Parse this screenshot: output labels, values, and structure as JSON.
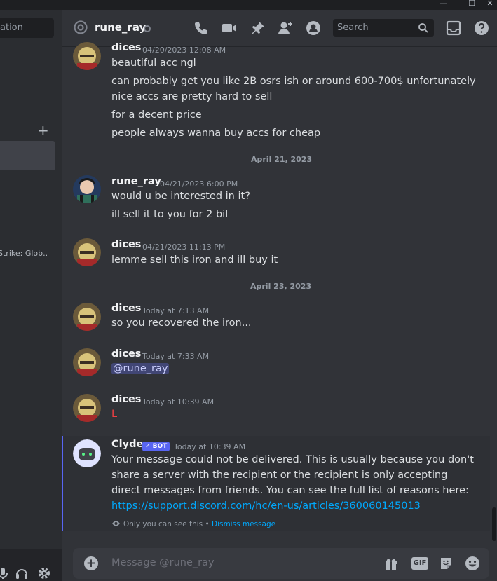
{
  "window": {
    "minimize": "—",
    "maximize": "☐",
    "close": "✕"
  },
  "sidebar": {
    "find_text": "ation",
    "dm_add": "+",
    "activity_status": "Strike: Glob..."
  },
  "header": {
    "username": "rune_ray",
    "search_placeholder": "Search"
  },
  "messages": [
    {
      "author": "dices",
      "timestamp": "04/20/2023 12:08 AM",
      "lines": [
        "beautiful acc ngl",
        "can probably get you like 2B osrs ish or around 600-700$ unfortunately",
        "nice accs are pretty hard to sell",
        "for a decent price",
        "people always wanna buy accs for cheap"
      ]
    },
    {
      "divider": "April 21, 2023"
    },
    {
      "author": "rune_ray",
      "timestamp": "04/21/2023 6:00 PM",
      "lines": [
        "would u be interested in it?",
        "ill sell it to you for 2 bil"
      ]
    },
    {
      "author": "dices",
      "timestamp": "04/21/2023 11:13 PM",
      "lines": [
        "lemme sell this iron and ill buy it"
      ]
    },
    {
      "divider": "April 23, 2023"
    },
    {
      "author": "dices",
      "timestamp": "Today at 7:13 AM",
      "lines": [
        "so you recovered the iron..."
      ]
    },
    {
      "author": "dices",
      "timestamp": "Today at 7:33 AM",
      "mention": "@rune_ray"
    },
    {
      "author": "dices",
      "timestamp": "Today at 10:39 AM",
      "lines": [
        "L"
      ]
    },
    {
      "author": "Clyde",
      "badge": "✓ BOT",
      "timestamp": "Today at 10:39 AM",
      "lines": [
        "Your message could not be delivered. This is usually because you don't",
        "share a server with the recipient or the recipient is only accepting",
        "direct messages from friends. You can see the full list of reasons here:"
      ],
      "link": "https://support.discord.com/hc/en-us/articles/360060145013",
      "ephemeral_note": "Only you can see this",
      "dismiss": "Dismiss message"
    }
  ],
  "composer": {
    "placeholder": "Message @rune_ray",
    "plus": "+",
    "gif": "GIF"
  },
  "colors": {
    "accent": "#5865f2",
    "link": "#00a8fc",
    "background": "#313338",
    "red_text": "#f23f43"
  },
  "icons": [
    "at-icon",
    "call-icon",
    "video-icon",
    "pin-icon",
    "add-friend-icon",
    "profile-icon",
    "search-icon",
    "inbox-icon",
    "help-icon",
    "gift-icon",
    "gif-icon",
    "sticker-icon",
    "emoji-icon",
    "mic-icon",
    "headphones-icon",
    "gear-icon",
    "eye-icon"
  ]
}
